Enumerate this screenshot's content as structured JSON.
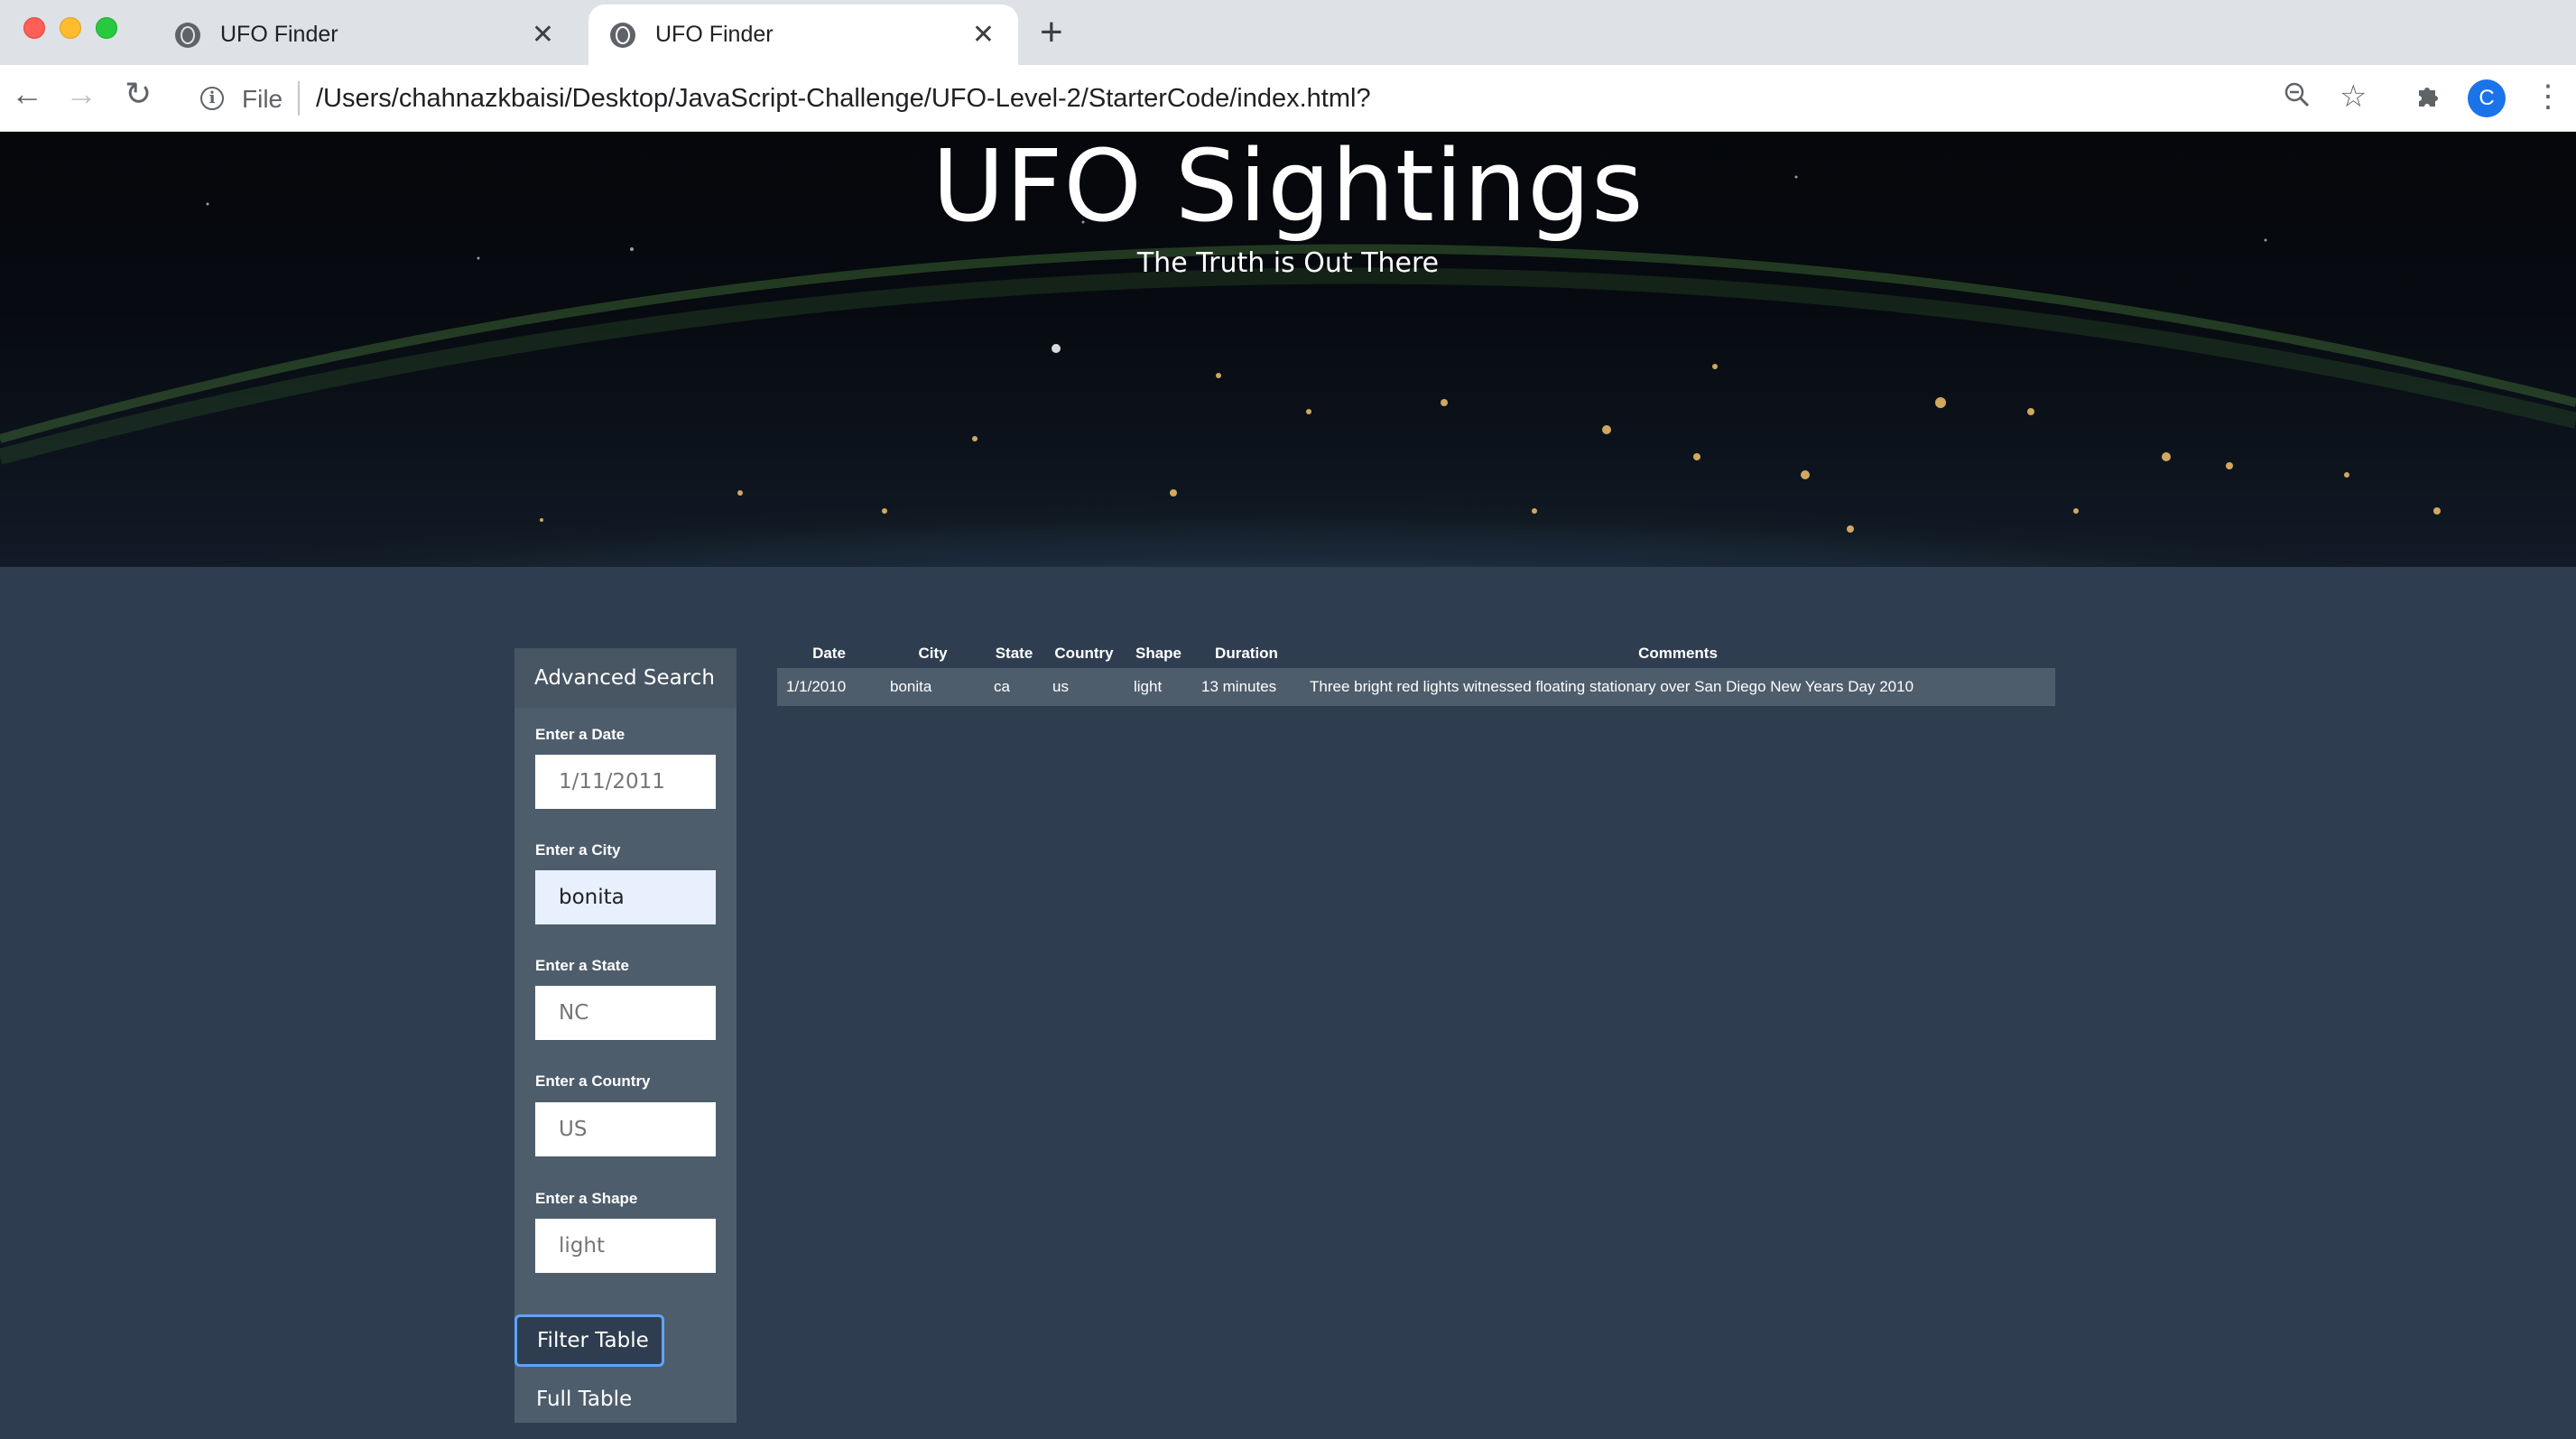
{
  "browser": {
    "tabs": [
      {
        "title": "UFO Finder",
        "active": false
      },
      {
        "title": "UFO Finder",
        "active": true
      }
    ],
    "address": {
      "scheme_label": "File",
      "url": "/Users/chahnazkbaisi/Desktop/JavaScript-Challenge/UFO-Level-2/StarterCode/index.html?"
    },
    "profile_initial": "C"
  },
  "hero": {
    "title": "UFO Sightings",
    "subtitle": "The Truth is Out There"
  },
  "sidebar": {
    "heading": "Advanced Search",
    "fields": [
      {
        "label": "Enter a Date",
        "value": "",
        "placeholder": "1/11/2011"
      },
      {
        "label": "Enter a City",
        "value": "bonita",
        "placeholder": ""
      },
      {
        "label": "Enter a State",
        "value": "",
        "placeholder": "NC"
      },
      {
        "label": "Enter a Country",
        "value": "",
        "placeholder": "US"
      },
      {
        "label": "Enter a Shape",
        "value": "",
        "placeholder": "light"
      }
    ],
    "filter_button": "Filter Table",
    "full_button": "Full Table"
  },
  "table": {
    "headers": [
      "Date",
      "City",
      "State",
      "Country",
      "Shape",
      "Duration",
      "Comments"
    ],
    "rows": [
      [
        "1/1/2010",
        "bonita",
        "ca",
        "us",
        "light",
        "13 minutes",
        "Three bright red lights witnessed floating stationary over San Diego New Years Day 2010"
      ]
    ]
  },
  "colors": {
    "page_bg": "#2e3e50",
    "panel_bg": "#4e5d6c",
    "focus_ring": "#5fa3ff"
  }
}
